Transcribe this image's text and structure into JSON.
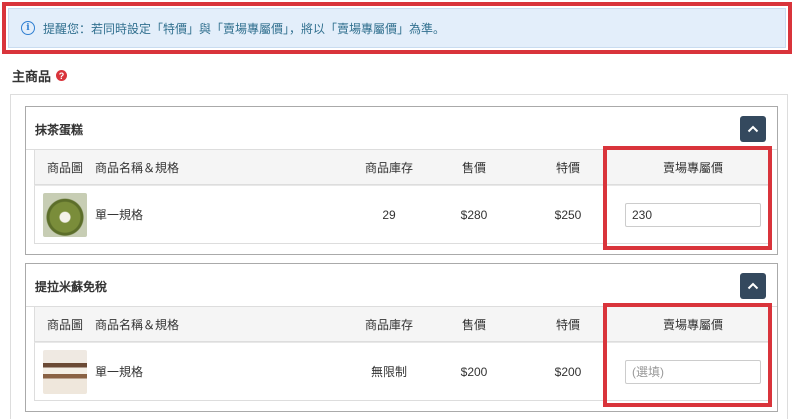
{
  "notice": {
    "text": "提醒您：若同時設定「特價」與「賣場專屬價」，將以「賣場專屬價」為準。"
  },
  "section": {
    "title": "主商品"
  },
  "table_headers": {
    "image": "商品圖",
    "name": "商品名稱＆規格",
    "stock": "商品庫存",
    "price": "售價",
    "sale": "特價",
    "venue_price": "賣場專屬價"
  },
  "products": [
    {
      "title": "抹茶蛋糕",
      "thumb": "matcha-cake-thumbnail",
      "spec": "單一規格",
      "stock": "29",
      "price": "$280",
      "sale": "$250",
      "venue_price_value": "230",
      "venue_price_placeholder": "(選填)"
    },
    {
      "title": "提拉米蘇免稅",
      "thumb": "tiramisu-thumbnail",
      "spec": "單一規格",
      "stock": "無限制",
      "price": "$200",
      "sale": "$200",
      "venue_price_value": "",
      "venue_price_placeholder": "(選填)"
    }
  ],
  "icons": {
    "notice": "info-icon",
    "help": "question-circle-icon",
    "collapse": "chevron-up-icon"
  },
  "colors": {
    "highlight": "#d9343b",
    "notice_bg": "#e3eefa",
    "button_bg": "#34495e"
  }
}
